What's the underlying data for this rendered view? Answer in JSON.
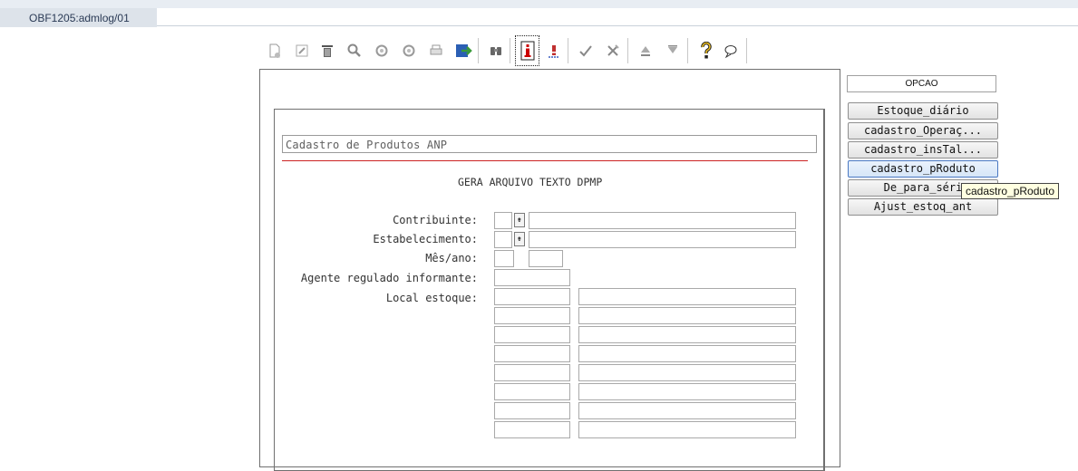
{
  "window": {
    "tab_label": "OBF1205:admlog/01"
  },
  "toolbar": {
    "icons": [
      "new-icon",
      "edit-icon",
      "delete-icon",
      "search-icon",
      "previous-icon",
      "next-icon",
      "print-icon",
      "import-icon",
      "find-icon",
      "info-icon",
      "exclamation-icon",
      "confirm-icon",
      "cancel-icon",
      "move-up-icon",
      "move-down-icon",
      "help-icon",
      "comment-icon"
    ]
  },
  "form": {
    "title_field": "Cadastro de Produtos ANP",
    "heading": "GERA ARQUIVO TEXTO DPMP",
    "labels": {
      "contribuinte": "Contribuinte:",
      "estabelecimento": "Estabelecimento:",
      "mes_ano": "Mês/ano:",
      "agente": "Agente regulado informante:",
      "local_estoque": "Local estoque:"
    }
  },
  "options": {
    "header": "OPCAO",
    "buttons": [
      "Estoque_diário",
      "cadastro_Operaç...",
      "cadastro_insTal...",
      "cadastro_pRoduto",
      "De_para_séri",
      "Ajust_estoq_ant"
    ],
    "active_index": 3,
    "tooltip": "cadastro_pRoduto"
  },
  "colors": {
    "accent_red": "#cc2222",
    "tooltip_bg": "#ffffe1",
    "active_border": "#4a78c2"
  }
}
